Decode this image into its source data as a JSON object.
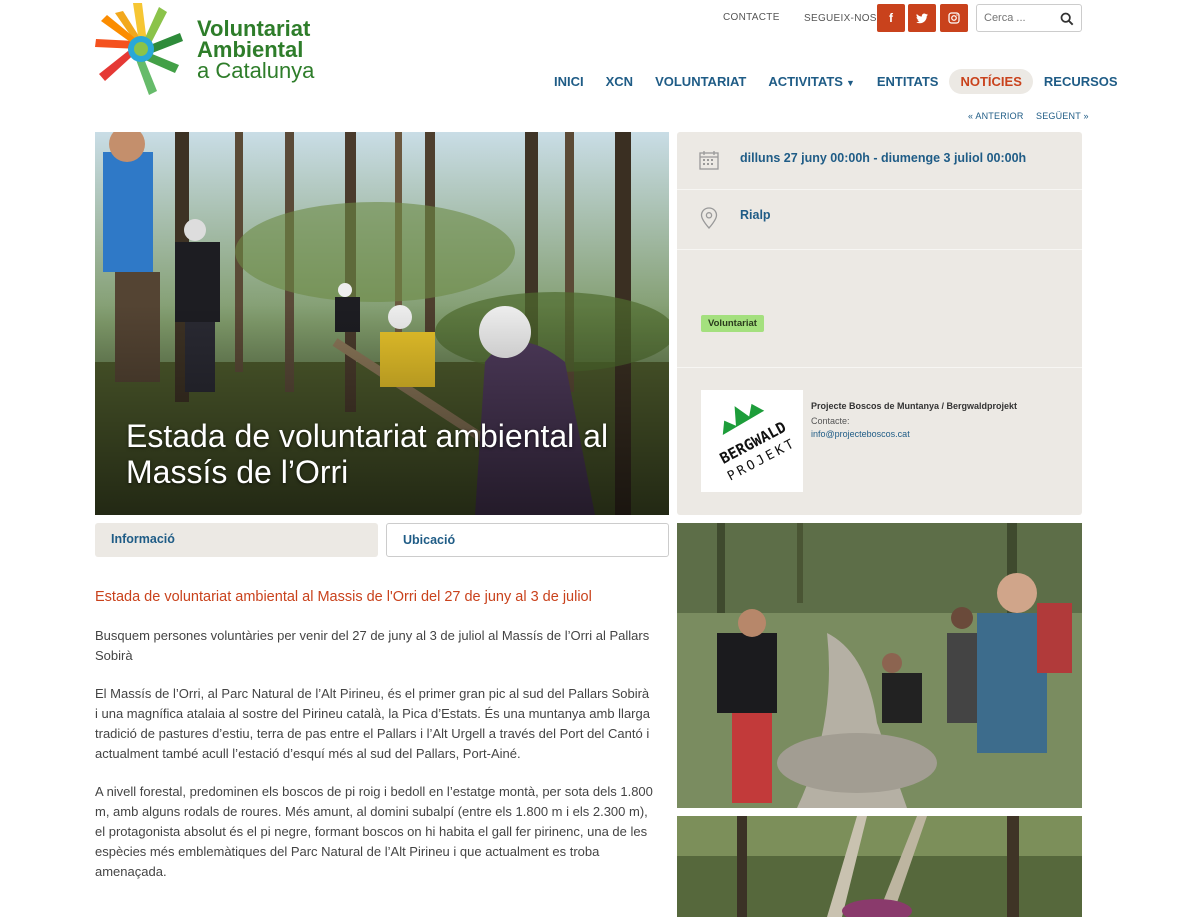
{
  "site": {
    "logo_line1": "Voluntariat",
    "logo_line2": "Ambiental",
    "logo_line3": "a Catalunya",
    "brand_green": "#2e7d2a",
    "accent": "#c9421c",
    "link_blue": "#1f5c86"
  },
  "topbar": {
    "contact": "CONTACTE",
    "follow": "SEGUEIX-NOS:",
    "social": [
      {
        "icon": "facebook-icon",
        "glyph": "f"
      },
      {
        "icon": "twitter-icon",
        "glyph": "t"
      },
      {
        "icon": "instagram-icon",
        "glyph": "◘"
      }
    ],
    "search_placeholder": "Cerca ..."
  },
  "nav": {
    "items": [
      {
        "label": "INICI"
      },
      {
        "label": "XCN"
      },
      {
        "label": "VOLUNTARIAT"
      },
      {
        "label": "ACTIVITATS"
      },
      {
        "label": "ENTITATS"
      },
      {
        "label": "NOTÍCIES",
        "active": true
      },
      {
        "label": "RECURSOS"
      }
    ]
  },
  "pager": {
    "prev": "« ANTERIOR",
    "next": "SEGÜENT »"
  },
  "hero": {
    "title": "Estada de voluntariat ambiental al Massís de l’Orri"
  },
  "event": {
    "date": "dilluns 27 juny 00:00h - diumenge 3 juliol 00:00h",
    "place": "Rialp",
    "tag": "Voluntariat",
    "org_name": "Projecte Boscos de Muntanya / Bergwaldprojekt",
    "contact_label": "Contacte:",
    "contact_email": "info@projecteboscos.cat",
    "org_logo_text_1": "BERGWALD",
    "org_logo_text_2": "PROJEKT"
  },
  "tabs": {
    "info": "Informació",
    "location": "Ubicació"
  },
  "article": {
    "lead": "Estada de voluntariat ambiental al Massis de l'Orri del 27 de juny al 3 de juliol",
    "p1": "Busquem persones voluntàries per venir del 27 de juny al 3 de juliol al Massís de l’Orri al Pallars Sobirà",
    "p2": "El Massís de l’Orri, al Parc Natural de l’Alt Pirineu, és el primer gran pic al sud del Pallars Sobirà i una magnífica atalaia al sostre del Pirineu català, la Pica d’Estats. És una muntanya amb llarga tradició de pastures d’estiu, terra de pas entre el Pallars i l’Alt Urgell a través del Port del Cantó i actualment també acull l’estació d’esquí més al sud del Pallars, Port-Ainé.",
    "p3": "A nivell forestal, predominen els boscos de pi roig i bedoll en l’estatge montà, per sota dels 1.800 m, amb alguns rodals de roures. Més amunt, al domini subalpí (entre els 1.800 m i els 2.300 m), el protagonista absolut és el pi negre, formant boscos on hi habita el gall fer pirinenc, una de les espècies més emblemàtiques del Parc Natural de l’Alt Pirineu i que actualment es troba amenaçada."
  }
}
